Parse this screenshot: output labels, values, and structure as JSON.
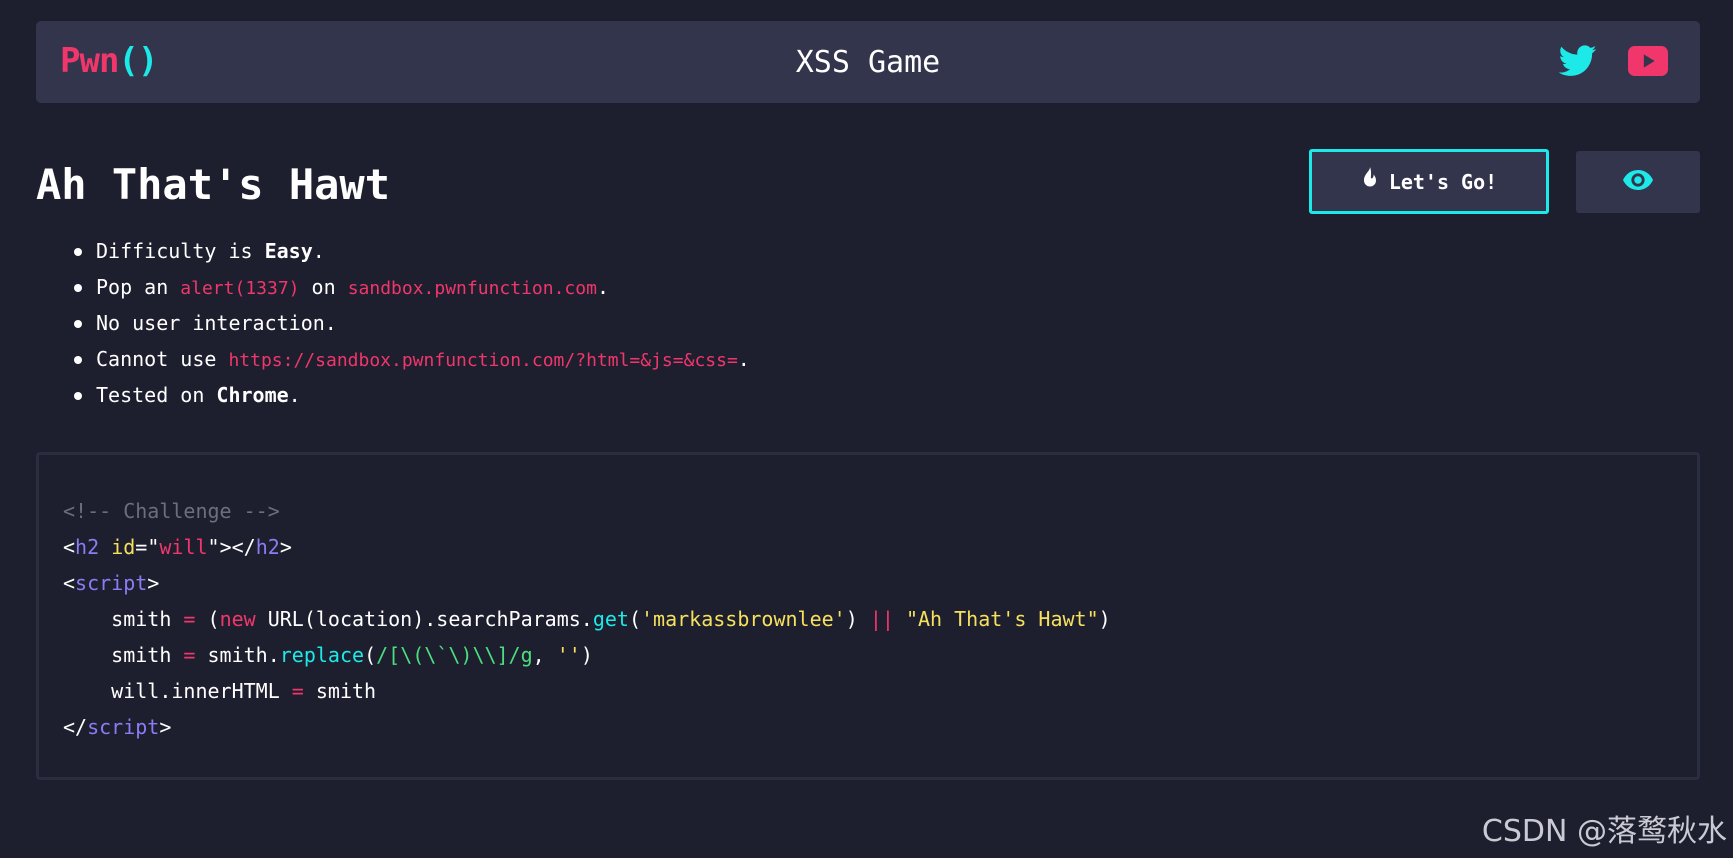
{
  "header": {
    "logo_pwn": "Pwn",
    "logo_paren": "()",
    "title": "XSS Game",
    "icons": [
      "twitter-icon",
      "youtube-icon"
    ]
  },
  "challenge": {
    "title": "Ah That's Hawt",
    "go_button": "Let's Go!",
    "rules": {
      "difficulty_prefix": "Difficulty is ",
      "difficulty": "Easy",
      "difficulty_suffix": ".",
      "pop_prefix": "Pop an ",
      "pop_code": "alert(1337)",
      "pop_mid": " on ",
      "pop_domain": "sandbox.pwnfunction.com",
      "pop_suffix": ".",
      "interaction": "No user interaction.",
      "cannot_prefix": "Cannot use ",
      "cannot_url": "https://sandbox.pwnfunction.com/?html=&js=&css=",
      "cannot_suffix": ".",
      "tested_prefix": "Tested on ",
      "tested_browser": "Chrome",
      "tested_suffix": "."
    }
  },
  "code": {
    "comment": "<!-- Challenge -->",
    "l2_open": "<",
    "l2_tag": "h2",
    "l2_sp": " ",
    "l2_attr": "id",
    "l2_eq": "=\"",
    "l2_val": "will",
    "l2_close": "\"></",
    "l2_tag2": "h2",
    "l2_end": ">",
    "l3_open": "<",
    "l3_tag": "script",
    "l3_end": ">",
    "l4_a": "    smith ",
    "l4_eq": "=",
    "l4_b": " (",
    "l4_new": "new",
    "l4_c": " URL(location).searchParams.",
    "l4_get": "get",
    "l4_d": "(",
    "l4_str": "'markassbrownlee'",
    "l4_e": ") ",
    "l4_or": "||",
    "l4_f": " ",
    "l4_str2": "\"Ah That's Hawt\"",
    "l4_g": ")",
    "l5_a": "    smith ",
    "l5_eq": "=",
    "l5_b": " smith.",
    "l5_fn": "replace",
    "l5_c": "(",
    "l5_regex": "/[\\(\\`\\)\\\\]/g",
    "l5_d": ", ",
    "l5_str": "''",
    "l5_e": ")",
    "l6_a": "    will.innerHTML ",
    "l6_eq": "=",
    "l6_b": " smith",
    "l7_open": "</",
    "l7_tag": "script",
    "l7_end": ">"
  },
  "watermark": "CSDN @落鹜秋水",
  "colors": {
    "background": "#1e1f2e",
    "panel": "#33354d",
    "accent_cyan": "#1de9e8",
    "accent_pink": "#f1366b"
  }
}
